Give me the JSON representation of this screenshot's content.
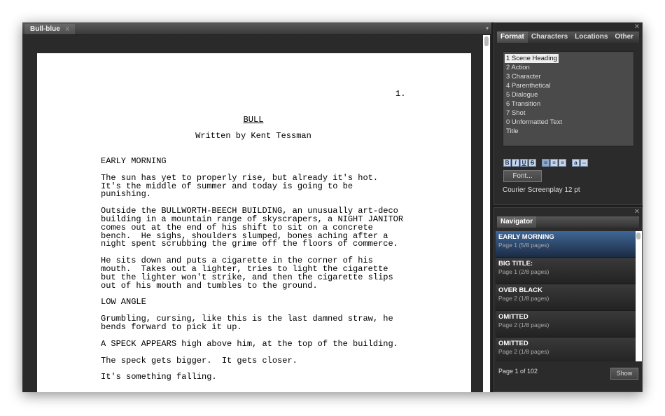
{
  "document": {
    "tab_title": "Bull-blue",
    "close_glyph": "x",
    "page_number": "1.",
    "title": "BULL",
    "byline": "Written by Kent Tessman",
    "paragraphs": [
      {
        "type": "scene",
        "text": "EARLY MORNING"
      },
      {
        "type": "action",
        "text": "The sun has yet to properly rise, but already it's hot.\nIt's the middle of summer and today is going to be\npunishing."
      },
      {
        "type": "action",
        "text": "Outside the BULLWORTH-BEECH BUILDING, an unusually art-deco\nbuilding in a mountain range of skyscrapers, a NIGHT JANITOR\ncomes out at the end of his shift to sit on a concrete\nbench.  He sighs, shoulders slumped, bones aching after a\nnight spent scrubbing the grime off the floors of commerce."
      },
      {
        "type": "action",
        "text": "He sits down and puts a cigarette in the corner of his\nmouth.  Takes out a lighter, tries to light the cigarette\nbut the lighter won't strike, and then the cigarette slips\nout of his mouth and tumbles to the ground."
      },
      {
        "type": "shot",
        "text": "LOW ANGLE"
      },
      {
        "type": "action",
        "text": "Grumbling, cursing, like this is the last damned straw, he\nbends forward to pick it up."
      },
      {
        "type": "action",
        "text": "A SPECK APPEARS high above him, at the top of the building."
      },
      {
        "type": "action",
        "text": "The speck gets bigger.  It gets closer."
      },
      {
        "type": "action",
        "text": "It's something falling."
      }
    ]
  },
  "format_panel": {
    "tabs": [
      "Format",
      "Characters",
      "Locations",
      "Other"
    ],
    "active_tab": "Format",
    "elements": [
      "1 Scene Heading",
      "2 Action",
      "3 Character",
      "4 Parenthetical",
      "5 Dialogue",
      "6 Transition",
      "7 Shot",
      "0 Unformatted Text",
      "Title"
    ],
    "selected": "1 Scene Heading",
    "tools": [
      "B",
      "I",
      "U",
      "S"
    ],
    "font_button": "Font...",
    "font_desc": "Courier Screenplay 12 pt"
  },
  "navigator": {
    "tab": "Navigator",
    "items": [
      {
        "title": "EARLY MORNING",
        "sub": "Page 1 (5/8 pages)"
      },
      {
        "title": "BIG TITLE:",
        "sub": "Page 1 (2/8 pages)"
      },
      {
        "title": "OVER BLACK",
        "sub": "Page 2 (1/8 pages)"
      },
      {
        "title": "OMITTED",
        "sub": "Page 2 (1/8 pages)"
      },
      {
        "title": "OMITTED",
        "sub": "Page 2 (1/8 pages)"
      }
    ],
    "page_info": "Page 1 of 102",
    "show_button": "Show"
  },
  "colors": {
    "selected_nav": "#3f6796",
    "background": "#2a2a2a"
  }
}
